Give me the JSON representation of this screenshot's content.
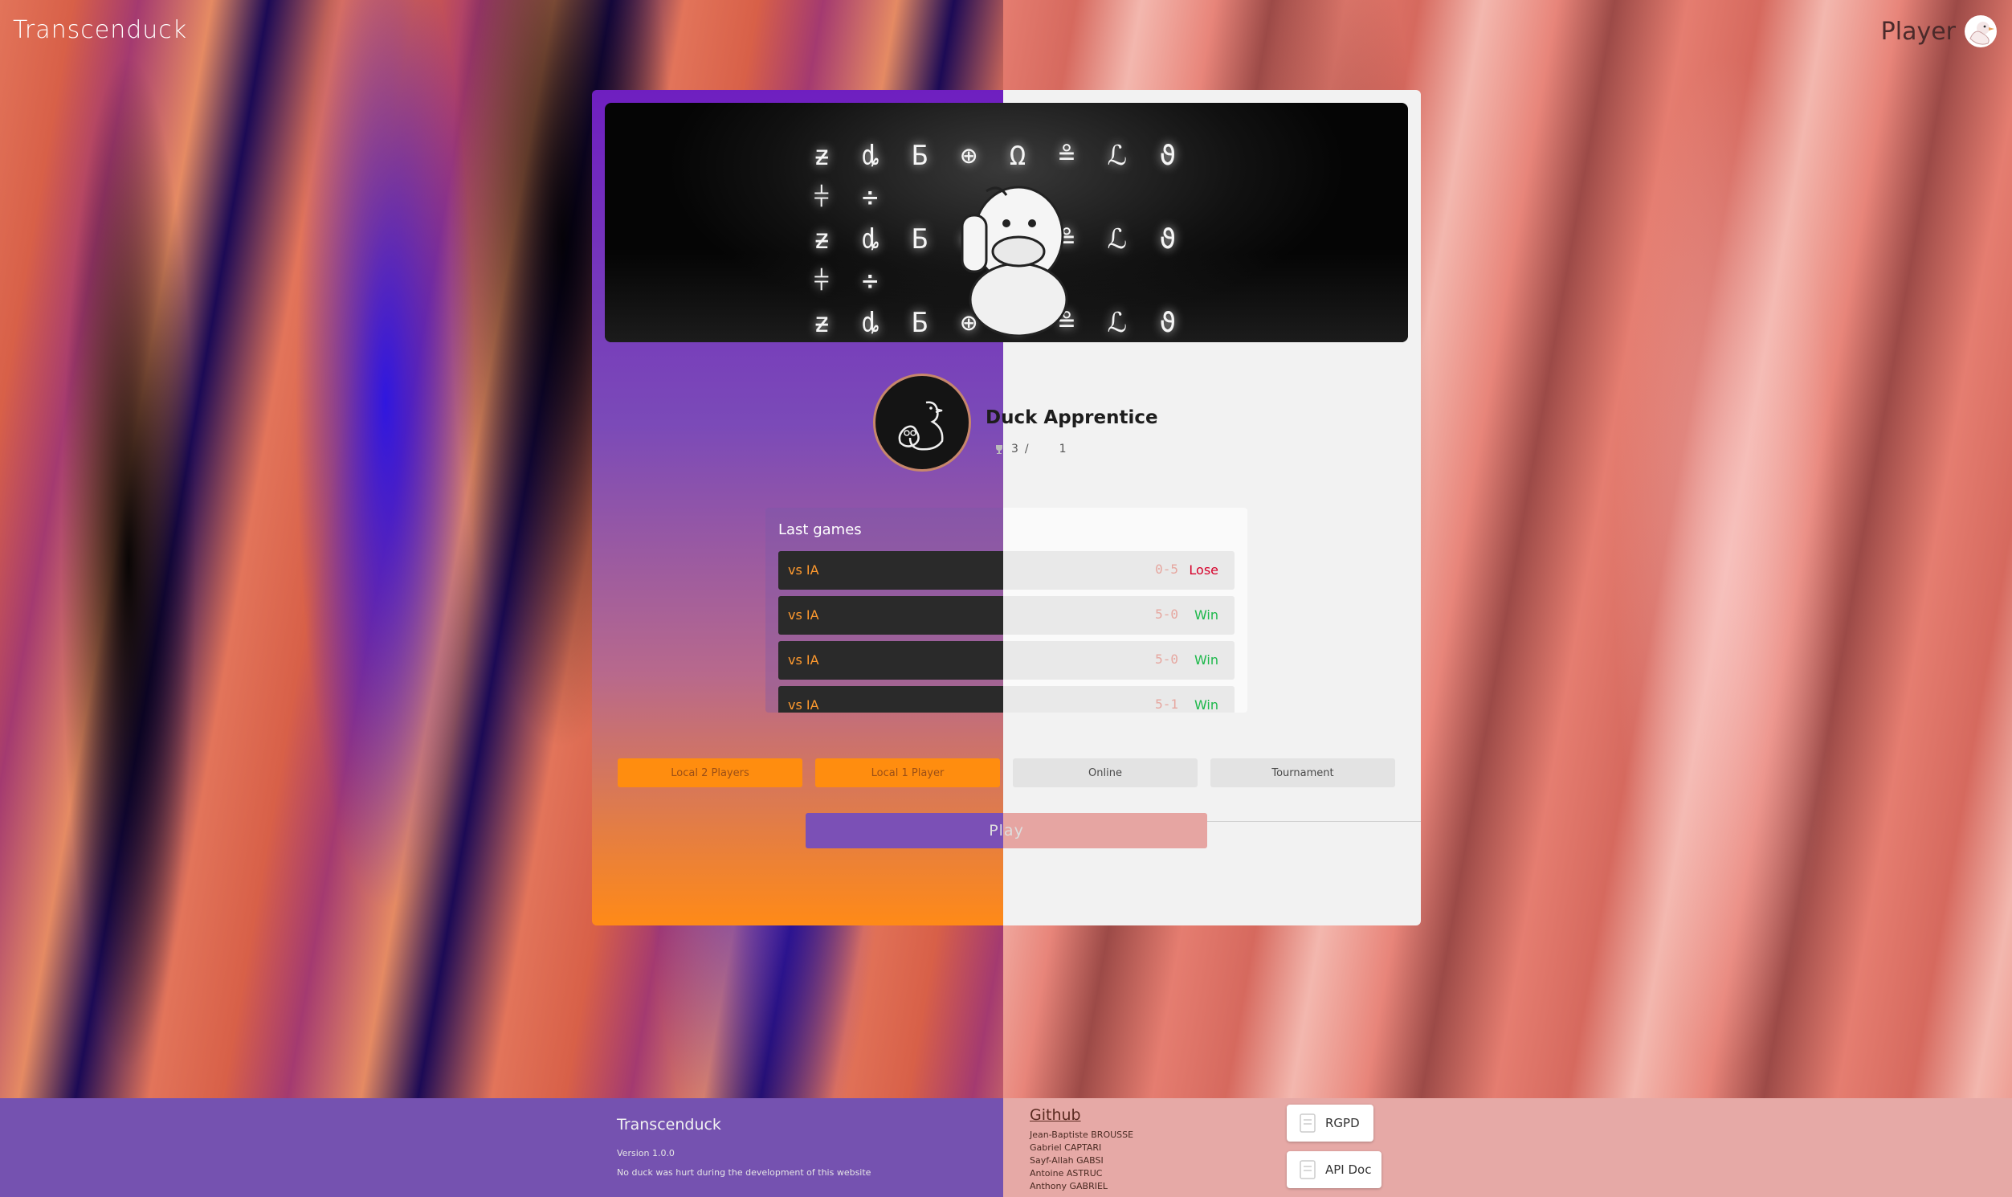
{
  "app": {
    "brand": "Transcenduck"
  },
  "header": {
    "player_label": "Player",
    "player_icon": "duck-avatar-icon"
  },
  "banner": {
    "glyph_rows": [
      "ƶ ȡ Ƃ ⊕ Ω ≗ ℒ ϑ ⫩ ÷",
      "ƶ ȡ Ƃ ⊕ Ω ≗ ℒ ϑ ⫩ ÷",
      "ƶ ȡ Ƃ ⊕ Ω ≗ ℒ ϑ ⫩ ÷"
    ]
  },
  "profile": {
    "rank": "Duck Apprentice",
    "wins": "3",
    "separator": "/",
    "losses": "1"
  },
  "last_games": {
    "title": "Last games",
    "rows": [
      {
        "opponent": "vs IA",
        "score": "0-5",
        "result": "Lose",
        "result_color": "#d6002a"
      },
      {
        "opponent": "vs IA",
        "score": "5-0",
        "result": "Win",
        "result_color": "#1cb84a"
      },
      {
        "opponent": "vs IA",
        "score": "5-0",
        "result": "Win",
        "result_color": "#1cb84a"
      },
      {
        "opponent": "vs IA",
        "score": "5-1",
        "result": "Win",
        "result_color": "#1cb84a"
      }
    ]
  },
  "modes": [
    {
      "label": "Local 2 Players",
      "active": true
    },
    {
      "label": "Local 1 Player",
      "active": true
    },
    {
      "label": "Online",
      "active": false
    },
    {
      "label": "Tournament",
      "active": false
    }
  ],
  "play": {
    "label": "Play"
  },
  "footer": {
    "brand": "Transcenduck",
    "version": "Version 1.0.0",
    "tagline": "No duck was hurt during the development of this website",
    "github_label": "Github",
    "authors": [
      "Jean-Baptiste BROUSSE",
      "Gabriel CAPTARI",
      "Sayf-Allah GABSI",
      "Antoine ASTRUC",
      "Anthony GABRIEL"
    ],
    "buttons": [
      {
        "label": "RGPD",
        "icon": "document-icon"
      },
      {
        "label": "API Doc",
        "icon": "document-icon"
      }
    ]
  },
  "colors": {
    "accent_orange": "#ff8d0f",
    "accent_purple": "#7552b0",
    "accent_pink": "#e6a9a6",
    "win": "#1cb84a",
    "lose": "#d6002a"
  }
}
